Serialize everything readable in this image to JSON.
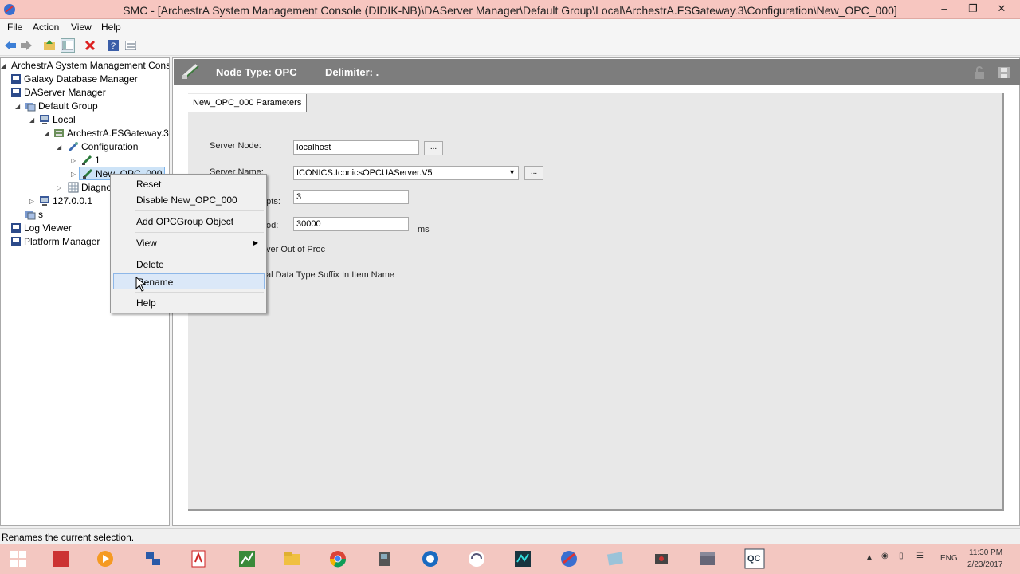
{
  "window": {
    "title": "SMC - [ArchestrA System Management Console (DIDIK-NB)\\DAServer Manager\\Default Group\\Local\\ArchestrA.FSGateway.3\\Configuration\\New_OPC_000]",
    "minimize": "–",
    "maximize": "❐",
    "close": "✕"
  },
  "menu": [
    "File",
    "Action",
    "View",
    "Help"
  ],
  "tree": {
    "root": "ArchestrA System Management Console",
    "galaxy": "Galaxy Database Manager",
    "daserver": "DAServer Manager",
    "default_group": "Default Group",
    "local": "Local",
    "fsgateway": "ArchestrA.FSGateway.3",
    "configuration": "Configuration",
    "node_1": "1",
    "node_opc": "New_OPC_000",
    "diagnostics": "Diagnostics",
    "ip_node": "127.0.0.1",
    "s_node": "s",
    "log_viewer": "Log Viewer",
    "platform_manager": "Platform Manager"
  },
  "header": {
    "node_type": "Node Type: OPC",
    "delimiter": "Delimiter:  ."
  },
  "tab": {
    "label": "New_OPC_000 Parameters"
  },
  "form": {
    "server_node_label": "Server Node:",
    "server_node_value": "localhost",
    "server_name_label": "Server Name:",
    "server_name_value": "ICONICS.IconicsOPCUAServer.V5",
    "attempts_label_fragment": "mpts:",
    "attempts_value": "3",
    "period_label_fragment": "od:",
    "period_value": "30000",
    "period_unit": "ms",
    "outproc_label_fragment": "ver Out of Proc",
    "suffix_label_fragment": "al Data Type Suffix In Item Name",
    "browse": "..."
  },
  "context_menu": {
    "reset": "Reset",
    "disable": "Disable New_OPC_000",
    "add_group": "Add OPCGroup Object",
    "view": "View",
    "delete": "Delete",
    "rename": "Rename",
    "help": "Help"
  },
  "status": "Renames the current selection.",
  "taskbar": {
    "time": "11:30 PM",
    "date": "2/23/2017",
    "lang": "ENG"
  },
  "colors": {
    "titlebar": "#f7c6c0",
    "taskbar": "#f3c7c1",
    "header": "#7d7d7d",
    "highlight": "#dbe8f8"
  }
}
